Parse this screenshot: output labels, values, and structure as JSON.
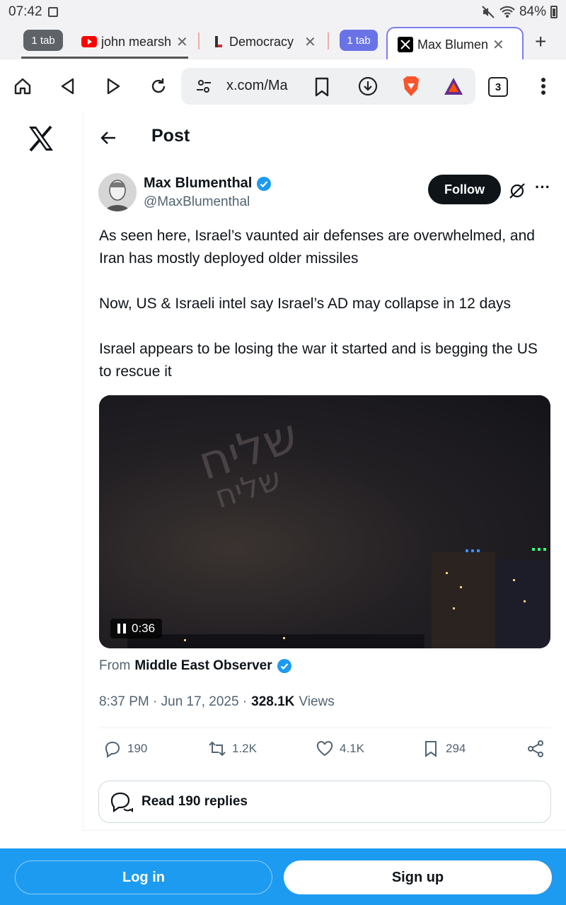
{
  "status_bar": {
    "time": "07:42",
    "battery": "84%"
  },
  "tabs": {
    "group1_label": "1 tab",
    "tab1_title": "john mearsh",
    "tab2_title": "Democracy",
    "group2_label": "1 tab",
    "active_title": "Max Blumen",
    "new_tab": "+"
  },
  "toolbar": {
    "url": "x.com/Ma",
    "tab_count": "3"
  },
  "page": {
    "title": "Post",
    "author": {
      "name": "Max Blumenthal",
      "handle": "@MaxBlumenthal"
    },
    "follow_label": "Follow",
    "text": [
      "As seen here, Israel’s vaunted air defenses are overwhelmed, and Iran has mostly deployed older missiles",
      "Now, US & Israeli intel say Israel’s AD may collapse in 12 days",
      "Israel appears to be losing the war it started and is begging the US to rescue it"
    ],
    "video": {
      "duration": "0:36",
      "watermark_line1": "שליח",
      "watermark_line2": "שליח"
    },
    "source_prefix": "From",
    "source_name": "Middle East Observer",
    "timestamp": "8:37 PM · Jun 17, 2025 ·",
    "views_count": "328.1K",
    "views_label": "Views",
    "stats": {
      "replies": "190",
      "reposts": "1.2K",
      "likes": "4.1K",
      "bookmarks": "294"
    },
    "read_replies": "Read 190 replies"
  },
  "bottom": {
    "login": "Log in",
    "signup": "Sign up"
  },
  "colors": {
    "accent": "#1d9bf0",
    "text": "#0f1419",
    "muted": "#536471"
  }
}
